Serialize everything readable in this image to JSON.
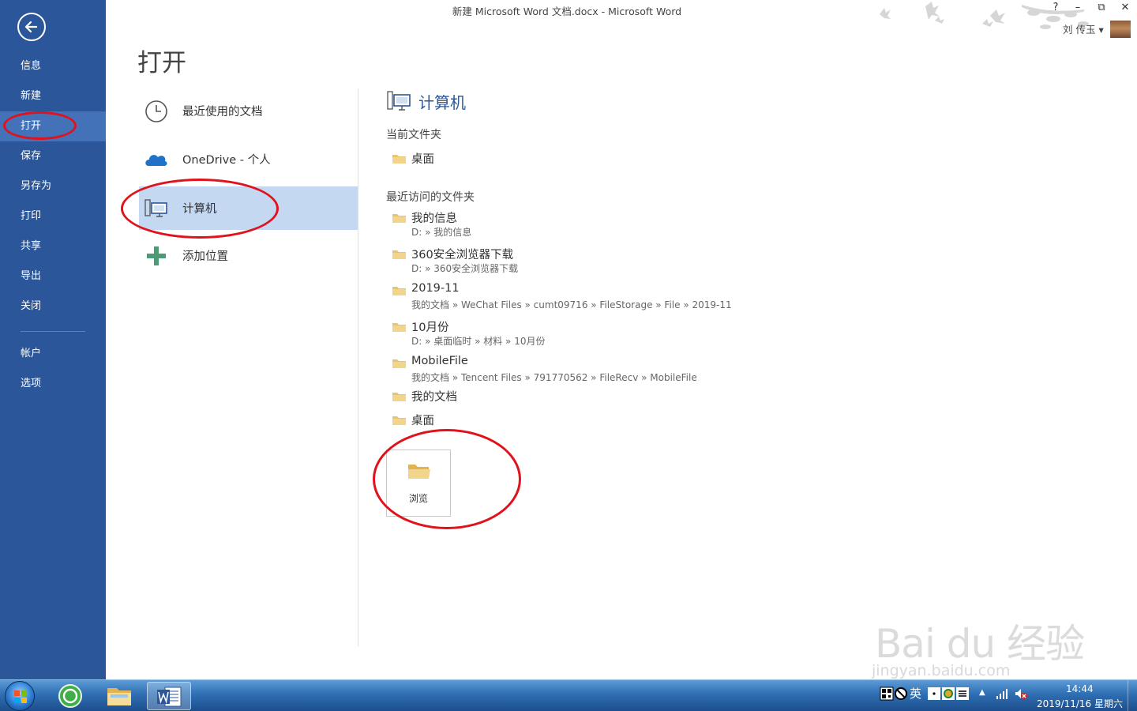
{
  "window": {
    "title": "新建 Microsoft Word 文档.docx - Microsoft Word",
    "help": "?",
    "minimize": "–",
    "restore": "⧉",
    "close": "✕"
  },
  "user": {
    "name": "刘 传玉 ▾"
  },
  "sidebar": {
    "items": [
      {
        "label": "信息"
      },
      {
        "label": "新建"
      },
      {
        "label": "打开"
      },
      {
        "label": "保存"
      },
      {
        "label": "另存为"
      },
      {
        "label": "打印"
      },
      {
        "label": "共享"
      },
      {
        "label": "导出"
      },
      {
        "label": "关闭"
      },
      {
        "label": "帐户"
      },
      {
        "label": "选项"
      }
    ]
  },
  "main": {
    "title": "打开",
    "places": [
      {
        "label": "最近使用的文档",
        "icon": "clock-icon"
      },
      {
        "label": "OneDrive - 个人",
        "icon": "cloud-icon"
      },
      {
        "label": "计算机",
        "icon": "computer-icon"
      },
      {
        "label": "添加位置",
        "icon": "plus-icon"
      }
    ],
    "computer": {
      "heading": "计算机",
      "current_label": "当前文件夹",
      "current_folder": {
        "name": "桌面"
      },
      "recent_label": "最近访问的文件夹",
      "recent_folders": [
        {
          "name": "我的信息",
          "path": "D: » 我的信息"
        },
        {
          "name": "360安全浏览器下载",
          "path": "D: » 360安全浏览器下载"
        },
        {
          "name": "2019-11",
          "path": "我的文档 » WeChat Files » cumt09716 » FileStorage » File » 2019-11"
        },
        {
          "name": "10月份",
          "path": "D: » 桌面临时 » 材料 » 10月份"
        },
        {
          "name": "MobileFile",
          "path": "我的文档 » Tencent Files » 791770562 » FileRecv » MobileFile"
        },
        {
          "name": "我的文档",
          "path": ""
        },
        {
          "name": "桌面",
          "path": ""
        }
      ],
      "browse_label": "浏览"
    }
  },
  "watermark": {
    "logo": "Bai du 经验",
    "url": "jingyan.baidu.com"
  },
  "taskbar": {
    "tray_ime": "英",
    "time": "14:44",
    "date": "2019/11/16 星期六"
  },
  "colors": {
    "accent": "#2b579a",
    "selected_place": "#c5d8f1",
    "annotation": "#e0131c",
    "folder": "#e8c46a"
  }
}
